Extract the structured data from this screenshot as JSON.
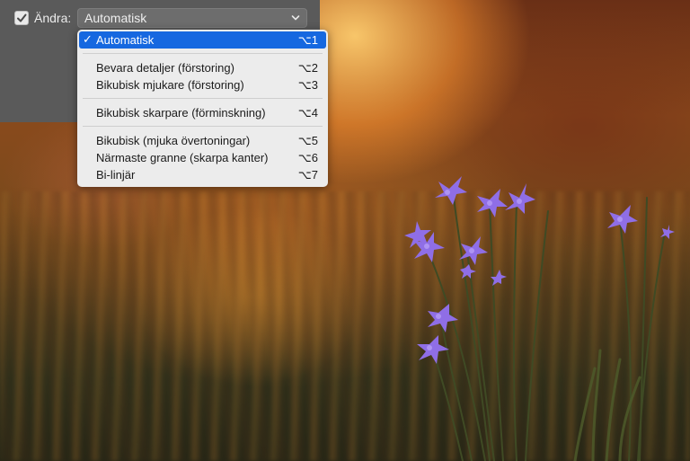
{
  "panel": {
    "checkbox_label": "Ändra:",
    "checked": true,
    "select_value": "Automatisk"
  },
  "menu": {
    "items": [
      {
        "label": "Automatisk",
        "shortcut": "⌥1",
        "selected": true
      },
      {
        "label": "Bevara detaljer (förstoring)",
        "shortcut": "⌥2"
      },
      {
        "label": "Bikubisk mjukare (förstoring)",
        "shortcut": "⌥3"
      },
      {
        "label": "Bikubisk skarpare (förminskning)",
        "shortcut": "⌥4"
      },
      {
        "label": "Bikubisk (mjuka övertoningar)",
        "shortcut": "⌥5"
      },
      {
        "label": "Närmaste granne (skarpa kanter)",
        "shortcut": "⌥6"
      },
      {
        "label": "Bi-linjär",
        "shortcut": "⌥7"
      }
    ],
    "check_mark": "✓"
  },
  "colors": {
    "panel_bg": "#5a5a5a",
    "menu_bg": "#ececec",
    "selection": "#1668e0",
    "flower": "#8f6ee6"
  },
  "icons": {
    "checkbox": "checkmark-icon",
    "select": "chevron-down-icon"
  }
}
